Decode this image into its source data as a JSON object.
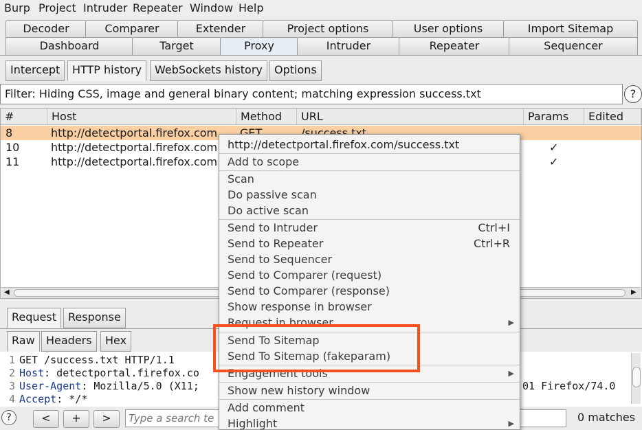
{
  "menubar": [
    "Burp",
    "Project",
    "Intruder",
    "Repeater",
    "Window",
    "Help"
  ],
  "tabs_row1": [
    "Decoder",
    "Comparer",
    "Extender",
    "Project options",
    "User options",
    "Import Sitemap"
  ],
  "tabs_row2": [
    "Dashboard",
    "Target",
    "Proxy",
    "Intruder",
    "Repeater",
    "Sequencer"
  ],
  "subtabs": [
    "Intercept",
    "HTTP history",
    "WebSockets history",
    "Options"
  ],
  "filter": {
    "text": "Filter: Hiding CSS, image and general binary content;  matching expression success.txt",
    "help": "?"
  },
  "table": {
    "columns": [
      "#",
      "Host",
      "Method",
      "URL",
      "Params",
      "Edited"
    ],
    "rows": [
      {
        "num": "8",
        "host": "http://detectportal.firefox.com",
        "method": "GET",
        "url": "/success.txt",
        "params": ""
      },
      {
        "num": "10",
        "host": "http://detectportal.firefox.com",
        "method": "",
        "url": "",
        "params": "✓"
      },
      {
        "num": "11",
        "host": "http://detectportal.firefox.com",
        "method": "",
        "url": "",
        "params": "✓"
      }
    ]
  },
  "context_menu": {
    "header": "http://detectportal.firefox.com/success.txt",
    "add_scope": "Add to scope",
    "scan": "Scan",
    "passive": "Do passive scan",
    "active": "Do active scan",
    "intruder": "Send to Intruder",
    "intruder_sc": "Ctrl+I",
    "repeater": "Send to Repeater",
    "repeater_sc": "Ctrl+R",
    "sequencer": "Send to Sequencer",
    "comparer_req": "Send to Comparer (request)",
    "comparer_resp": "Send to Comparer (response)",
    "show_browser": "Show response in browser",
    "req_browser": "Request in browser",
    "sitemap": "Send To Sitemap",
    "sitemap_fake": "Send To Sitemap (fakeparam)",
    "engagement": "Engagement tools",
    "new_window": "Show new history window",
    "add_comment": "Add comment",
    "highlight": "Highlight"
  },
  "msg_tabs": [
    "Request",
    "Response"
  ],
  "view_tabs": [
    "Raw",
    "Headers",
    "Hex"
  ],
  "request_lines": [
    {
      "n": "1",
      "key": "",
      "val": "GET /success.txt HTTP/1.1"
    },
    {
      "n": "2",
      "key": "Host",
      "val": ": detectportal.firefox.co"
    },
    {
      "n": "3",
      "key": "User-Agent",
      "val": ": Mozilla/5.0 (X11;"
    },
    {
      "n": "4",
      "key": "Accept",
      "val": ": */*"
    }
  ],
  "request_tail": "01 Firefox/74.0",
  "search": {
    "placeholder": "Type a search te",
    "prev": "<",
    "add": "+",
    "next": ">",
    "matches": "0 matches",
    "help": "?"
  },
  "colors": {
    "selected_row": "#f9cfa3",
    "highlight_box": "#f4511e",
    "header_key": "#1a3a8a"
  }
}
